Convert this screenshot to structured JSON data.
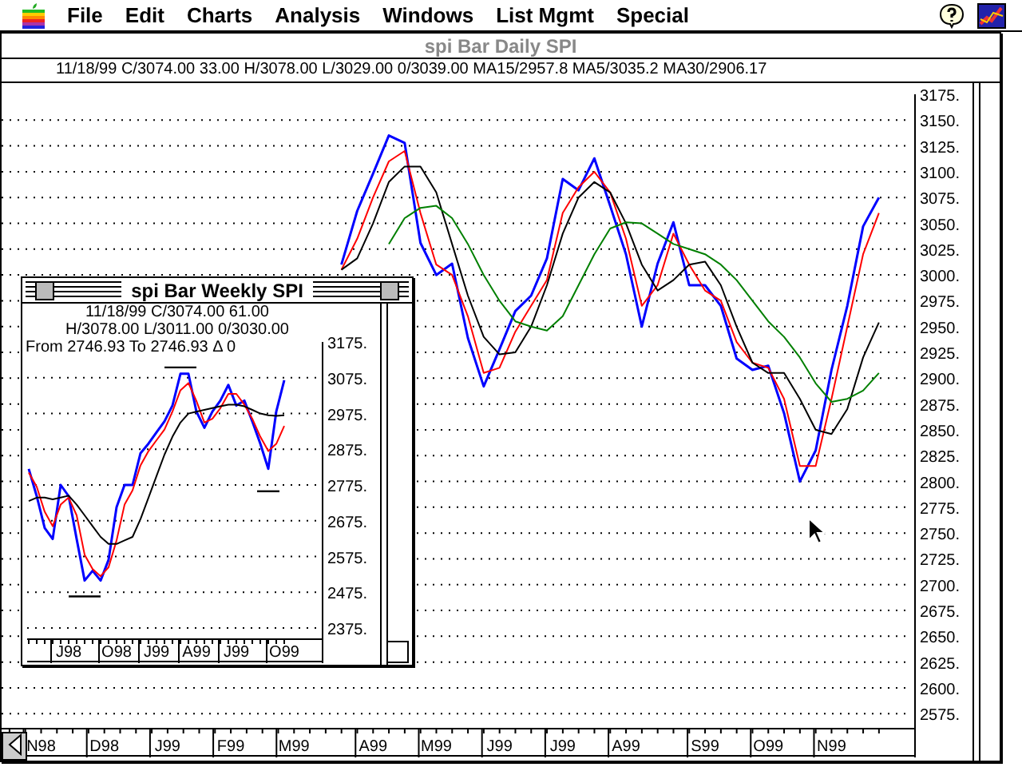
{
  "menu_bar": {
    "items": [
      "File",
      "Edit",
      "Charts",
      "Analysis",
      "Windows",
      "List Mgmt",
      "Special"
    ]
  },
  "daily_window": {
    "title": "spi Bar Daily  SPI",
    "active": false,
    "header": "11/18/99 C/3074.00 33.00 H/3078.00 L/3029.00 0/3039.00 MA15/2957.8 MA5/3035.2 MA30/2906.17",
    "chart_data": {
      "type": "line",
      "grid": true,
      "ylim": [
        2560.5,
        3175
      ],
      "categories": [
        null,
        null,
        "N98",
        null,
        null,
        null,
        "D98",
        null,
        null,
        null,
        "J99",
        null,
        null,
        null,
        "F99",
        null,
        null,
        null,
        "M99",
        null,
        null,
        null,
        null,
        "A99",
        null,
        null,
        null,
        "M99",
        null,
        null,
        null,
        "J99",
        null,
        null,
        null,
        "J99",
        null,
        null,
        null,
        "A99",
        null,
        null,
        null,
        null,
        "S99",
        null,
        null,
        null,
        "O99",
        null,
        null,
        null,
        "N99",
        null,
        null,
        null
      ],
      "yticks": [
        {
          "value": 3175,
          "label": "3175."
        },
        {
          "value": 3150,
          "label": "3150."
        },
        {
          "value": 3125,
          "label": "3125."
        },
        {
          "value": 3100,
          "label": "3100."
        },
        {
          "value": 3075,
          "label": "3075."
        },
        {
          "value": 3050,
          "label": "3050."
        },
        {
          "value": 3025,
          "label": "3025."
        },
        {
          "value": 3000,
          "label": "3000."
        },
        {
          "value": 2975,
          "label": "2975."
        },
        {
          "value": 2950,
          "label": "2950."
        },
        {
          "value": 2925,
          "label": "2925."
        },
        {
          "value": 2900,
          "label": "2900."
        },
        {
          "value": 2875,
          "label": "2875."
        },
        {
          "value": 2850,
          "label": "2850."
        },
        {
          "value": 2825,
          "label": "2825."
        },
        {
          "value": 2800,
          "label": "2800."
        },
        {
          "value": 2775,
          "label": "2775."
        },
        {
          "value": 2750,
          "label": "2750."
        },
        {
          "value": 2725,
          "label": "2725."
        },
        {
          "value": 2700,
          "label": "2700."
        },
        {
          "value": 2675,
          "label": "2675."
        },
        {
          "value": 2650,
          "label": "2650."
        },
        {
          "value": 2625,
          "label": "2625."
        },
        {
          "value": 2600,
          "label": "2600."
        },
        {
          "value": 2575,
          "label": "2575."
        }
      ],
      "series": [
        {
          "color": "#0000ff",
          "values": [
            null,
            null,
            null,
            null,
            null,
            null,
            null,
            null,
            null,
            null,
            null,
            null,
            null,
            null,
            null,
            null,
            null,
            null,
            null,
            null,
            null,
            3010,
            3062,
            3098,
            3135,
            3128,
            3031,
            3000,
            3011,
            2939,
            2892,
            2928,
            2965,
            2980,
            3016,
            3093,
            3082,
            3113,
            3067,
            3020,
            2950,
            3011,
            3051,
            2990,
            2990,
            2970,
            2919,
            2908,
            2912,
            2866,
            2800,
            2830,
            2908,
            2970,
            3047,
            3075
          ]
        },
        {
          "color": "#ff0000",
          "values": [
            null,
            null,
            null,
            null,
            null,
            null,
            null,
            null,
            null,
            null,
            null,
            null,
            null,
            null,
            null,
            null,
            null,
            null,
            null,
            null,
            null,
            3005,
            3035,
            3075,
            3110,
            3120,
            3060,
            3010,
            3000,
            2960,
            2905,
            2910,
            2945,
            2970,
            2995,
            3060,
            3085,
            3100,
            3080,
            3035,
            2970,
            2990,
            3040,
            3010,
            2985,
            2975,
            2935,
            2915,
            2910,
            2880,
            2815,
            2815,
            2880,
            2950,
            3020,
            3060
          ]
        },
        {
          "color": "#000000",
          "values": [
            null,
            null,
            null,
            null,
            null,
            null,
            null,
            null,
            null,
            null,
            null,
            null,
            null,
            null,
            null,
            null,
            null,
            null,
            null,
            null,
            null,
            3005,
            3016,
            3050,
            3090,
            3105,
            3105,
            3080,
            3030,
            2980,
            2940,
            2923,
            2925,
            2950,
            2990,
            3040,
            3075,
            3090,
            3080,
            3050,
            3010,
            2985,
            2995,
            3010,
            3013,
            2990,
            2950,
            2915,
            2905,
            2905,
            2880,
            2850,
            2846,
            2870,
            2920,
            2954
          ]
        },
        {
          "color": "#008000",
          "values": [
            null,
            null,
            null,
            null,
            null,
            null,
            null,
            null,
            null,
            null,
            null,
            null,
            null,
            null,
            null,
            null,
            null,
            null,
            null,
            null,
            null,
            null,
            null,
            null,
            3030,
            3055,
            3065,
            3067,
            3055,
            3030,
            3000,
            2975,
            2955,
            2950,
            2946,
            2960,
            2990,
            3020,
            3045,
            3051,
            3050,
            3040,
            3030,
            3025,
            3020,
            3010,
            2995,
            2975,
            2955,
            2940,
            2920,
            2895,
            2877,
            2880,
            2888,
            2905
          ]
        }
      ]
    }
  },
  "weekly_window": {
    "title": "spi Bar Weekly  SPI",
    "active": true,
    "header": [
      "11/18/99 C/3074.00 61.00",
      "H/3078.00 L/3011.00 0/3030.00",
      "From  2746.93 To  2746.93 Δ  0"
    ],
    "chart_data": {
      "type": "line",
      "grid": true,
      "ylim": [
        2343.9,
        3175
      ],
      "categories": [
        null,
        null,
        null,
        null,
        null,
        "J98",
        null,
        null,
        null,
        null,
        null,
        "O98",
        null,
        null,
        null,
        null,
        "J99",
        null,
        null,
        null,
        null,
        "A99",
        null,
        null,
        null,
        null,
        "J99",
        null,
        null,
        null,
        null,
        null,
        "O99"
      ],
      "yticks": [
        {
          "value": 3175,
          "label": "3175."
        },
        {
          "value": 3075,
          "label": "3075."
        },
        {
          "value": 2975,
          "label": "2975."
        },
        {
          "value": 2875,
          "label": "2875."
        },
        {
          "value": 2775,
          "label": "2775."
        },
        {
          "value": 2675,
          "label": "2675."
        },
        {
          "value": 2575,
          "label": "2575."
        },
        {
          "value": 2475,
          "label": "2475."
        },
        {
          "value": 2375,
          "label": "2375."
        }
      ],
      "series": [
        {
          "color": "#0000ff",
          "values": [
            2820,
            2744,
            2655,
            2624,
            2775,
            2744,
            2624,
            2508,
            2535,
            2508,
            2566,
            2713,
            2775,
            2775,
            2864,
            2891,
            2922,
            2953,
            2997,
            3086,
            3086,
            2980,
            2935,
            2980,
            3011,
            3055,
            2997,
            3011,
            2953,
            2891,
            2820,
            2980,
            3068
          ]
        },
        {
          "color": "#ff0000",
          "values": [
            2810,
            2770,
            2700,
            2660,
            2720,
            2740,
            2690,
            2580,
            2540,
            2520,
            2545,
            2620,
            2720,
            2760,
            2830,
            2870,
            2900,
            2930,
            2980,
            3040,
            3060,
            3010,
            2950,
            2960,
            2990,
            3030,
            3030,
            3000,
            2960,
            2910,
            2870,
            2890,
            2940
          ]
        },
        {
          "color": "#000000",
          "values": [
            2730,
            2740,
            2740,
            2735,
            2740,
            2745,
            2720,
            2690,
            2660,
            2630,
            2610,
            2610,
            2620,
            2630,
            2680,
            2740,
            2800,
            2860,
            2910,
            2950,
            2975,
            2980,
            2985,
            2990,
            2995,
            3000,
            3000,
            2995,
            2985,
            2975,
            2970,
            2968,
            2970
          ]
        }
      ]
    }
  }
}
